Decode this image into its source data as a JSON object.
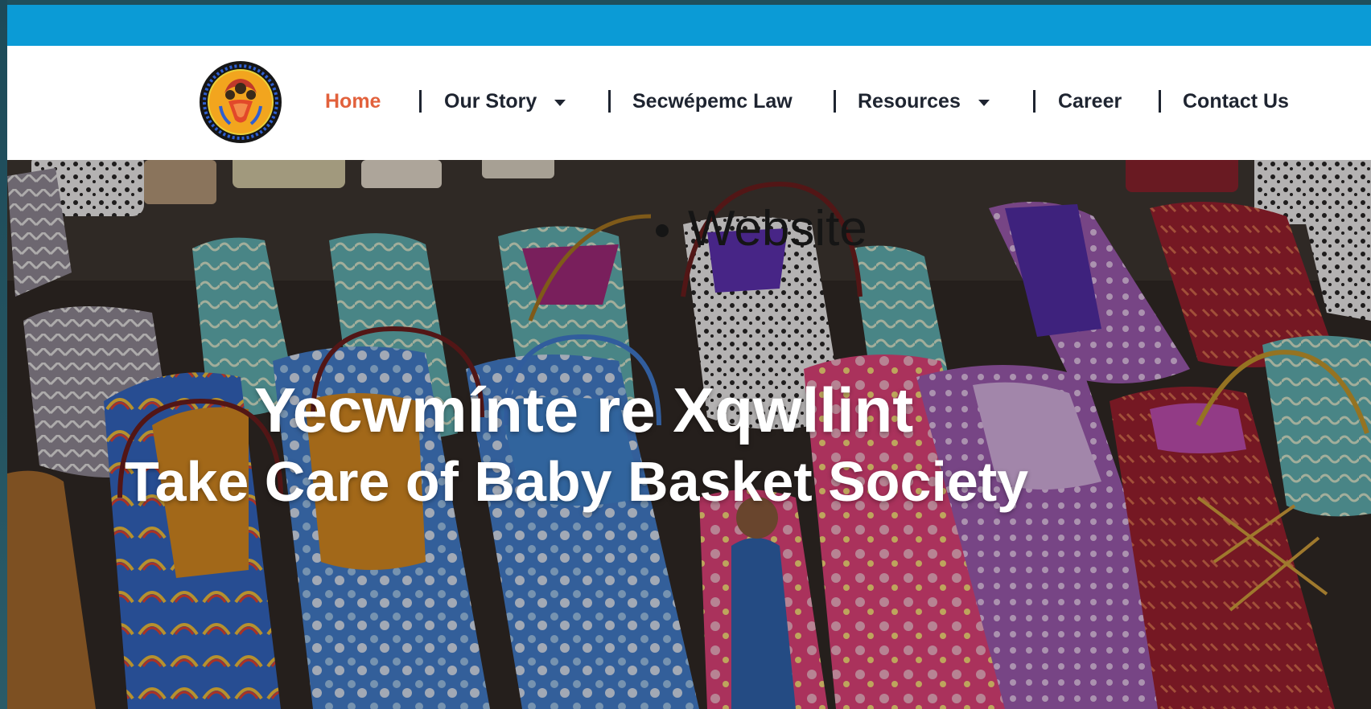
{
  "brand": {
    "logo_icon": "circular-beaded-basket-logo-icon",
    "colors": {
      "top_bar": "#0b9bd6",
      "nav_active": "#e2613c",
      "nav_text": "#1e2430"
    }
  },
  "nav": {
    "items": [
      {
        "label": "Home",
        "active": true
      },
      {
        "label": "Our Story",
        "dropdown": true
      },
      {
        "label": "Secwépemc Law"
      },
      {
        "label": "Resources",
        "dropdown": true
      },
      {
        "label": "Career"
      },
      {
        "label": "Contact Us"
      }
    ],
    "separator": "|",
    "dropdown_icon": "caret-down-icon"
  },
  "hero": {
    "list_item": "Website",
    "title": "Yecwmínte re Xqwllint",
    "subtitle": "Take Care of Baby Basket Society",
    "background": "photo-of-decorated-baby-baskets"
  }
}
